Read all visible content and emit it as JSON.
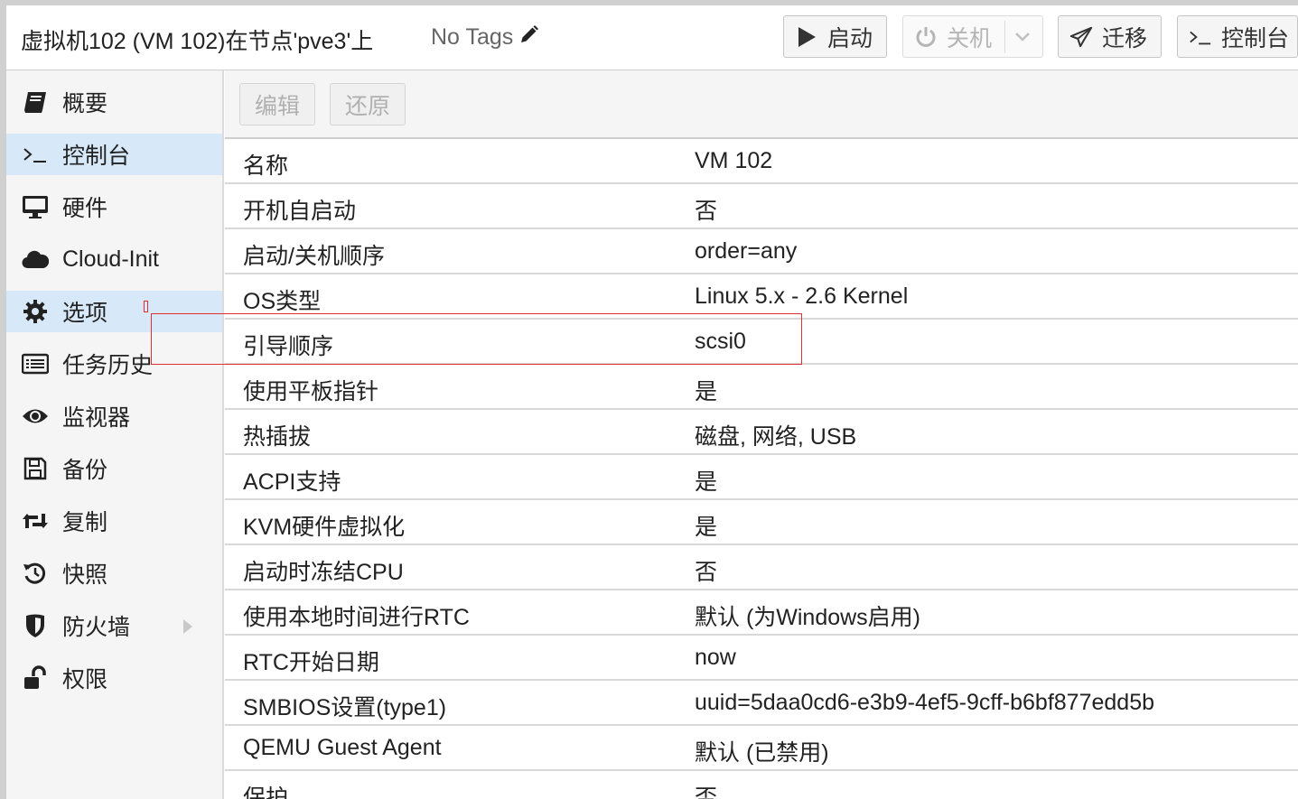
{
  "header": {
    "title": "虚拟机102 (VM 102)在节点'pve3'上",
    "tags_label": "No Tags",
    "buttons": {
      "start": "启动",
      "shutdown": "关机",
      "migrate": "迁移",
      "console": "控制台"
    }
  },
  "sidebar": {
    "items": [
      {
        "label": "概要",
        "icon": "book-icon"
      },
      {
        "label": "控制台",
        "icon": "terminal-icon"
      },
      {
        "label": "硬件",
        "icon": "monitor-icon"
      },
      {
        "label": "Cloud-Init",
        "icon": "cloud-icon"
      },
      {
        "label": "选项",
        "icon": "gear-icon"
      },
      {
        "label": "任务历史",
        "icon": "list-icon"
      },
      {
        "label": "监视器",
        "icon": "eye-icon"
      },
      {
        "label": "备份",
        "icon": "floppy-icon"
      },
      {
        "label": "复制",
        "icon": "retweet-icon"
      },
      {
        "label": "快照",
        "icon": "history-icon"
      },
      {
        "label": "防火墙",
        "icon": "shield-icon"
      },
      {
        "label": "权限",
        "icon": "unlock-icon"
      }
    ]
  },
  "toolbar": {
    "edit": "编辑",
    "revert": "还原"
  },
  "options": [
    {
      "key": "名称",
      "value": "VM 102"
    },
    {
      "key": "开机自启动",
      "value": "否"
    },
    {
      "key": "启动/关机顺序",
      "value": "order=any"
    },
    {
      "key": "OS类型",
      "value": "Linux 5.x - 2.6 Kernel"
    },
    {
      "key": "引导顺序",
      "value": "scsi0"
    },
    {
      "key": "使用平板指针",
      "value": "是"
    },
    {
      "key": "热插拔",
      "value": "磁盘, 网络, USB"
    },
    {
      "key": "ACPI支持",
      "value": "是"
    },
    {
      "key": "KVM硬件虚拟化",
      "value": "是"
    },
    {
      "key": "启动时冻结CPU",
      "value": "否"
    },
    {
      "key": "使用本地时间进行RTC",
      "value": "默认 (为Windows启用)"
    },
    {
      "key": "RTC开始日期",
      "value": "now"
    },
    {
      "key": "SMBIOS设置(type1)",
      "value": "uuid=5daa0cd6-e3b9-4ef5-9cff-b6bf877edd5b"
    },
    {
      "key": "QEMU Guest Agent",
      "value": "默认 (已禁用)"
    },
    {
      "key": "保护",
      "value": "否"
    }
  ],
  "colors": {
    "selected_nav_bg": "#d7e8f8",
    "annotation": "#e03030"
  }
}
